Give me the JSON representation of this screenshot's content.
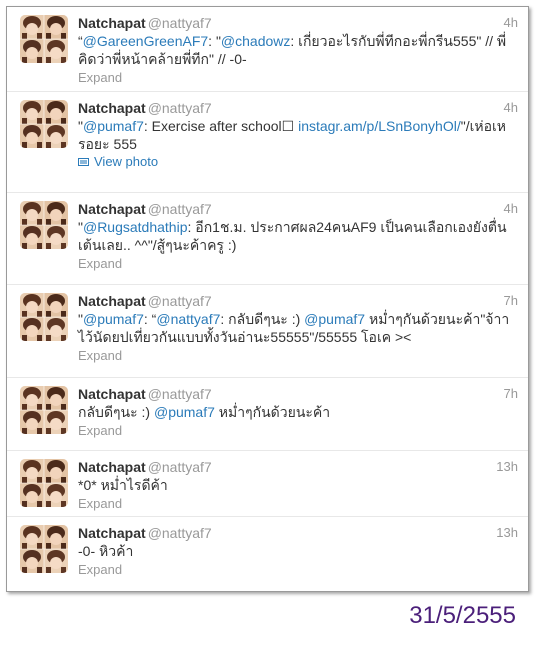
{
  "timeline": {
    "tweets": [
      {
        "fullname": "Natchapat",
        "username": "@nattyaf7",
        "time": "4h",
        "text_parts": [
          {
            "t": "“",
            "link": false
          },
          {
            "t": "@GareenGreenAF7",
            "link": true
          },
          {
            "t": ": \"",
            "link": false
          },
          {
            "t": "@chadowz",
            "link": true
          },
          {
            "t": ": เกี่ยวอะไรกับพี่ทีกอะพี่กรีน555\" // พี่คิดว่าพี่หน้าคล้ายพี่ทีก\" // -0-",
            "link": false
          }
        ],
        "expand": "Expand",
        "height": 85
      },
      {
        "fullname": "Natchapat",
        "username": "@nattyaf7",
        "time": "4h",
        "text_parts": [
          {
            "t": "\"",
            "link": false
          },
          {
            "t": "@pumaf7",
            "link": true
          },
          {
            "t": ": Exercise after school☐ ",
            "link": false
          },
          {
            "t": "instagr.am/p/LSnBonyhOl/",
            "link": true
          },
          {
            "t": "\"/เห่อเหรอยะ 555",
            "link": false
          }
        ],
        "view_photo": "View photo",
        "height": 101
      },
      {
        "fullname": "Natchapat",
        "username": "@nattyaf7",
        "time": "4h",
        "text_parts": [
          {
            "t": "\"",
            "link": false
          },
          {
            "t": "@Rugsatdhathip",
            "link": true
          },
          {
            "t": ": อีก1ช.ม. ประกาศผล24คนAF9 เป็นคนเลือกเองยังตื่นเต้นเลย.. ^^\"/สู้ๆนะค้าครู :)",
            "link": false
          }
        ],
        "expand": "Expand",
        "height": 92
      },
      {
        "fullname": "Natchapat",
        "username": "@nattyaf7",
        "time": "7h",
        "text_parts": [
          {
            "t": "\"",
            "link": false
          },
          {
            "t": "@pumaf7",
            "link": true
          },
          {
            "t": ": “",
            "link": false
          },
          {
            "t": "@nattyaf7",
            "link": true
          },
          {
            "t": ": กลับดีๆนะ :) ",
            "link": false
          },
          {
            "t": "@pumaf7",
            "link": true
          },
          {
            "t": " หม่ำๆกันด้วยนะค้า\"จ้าาไว้นัดยปเที่ยวกันแบบทั้งวันอ่านะ55555\"/55555 โอเค ><",
            "link": false
          }
        ],
        "expand": "Expand",
        "height": 93
      },
      {
        "fullname": "Natchapat",
        "username": "@nattyaf7",
        "time": "7h",
        "text_parts": [
          {
            "t": "กลับดีๆนะ :) ",
            "link": false
          },
          {
            "t": "@pumaf7",
            "link": true
          },
          {
            "t": " หม่ำๆกันด้วยนะค้า",
            "link": false
          }
        ],
        "expand": "Expand",
        "height": 73
      },
      {
        "fullname": "Natchapat",
        "username": "@nattyaf7",
        "time": "13h",
        "text_parts": [
          {
            "t": "*0* หม่ำไรดีค้า",
            "link": false
          }
        ],
        "expand": "Expand",
        "height": 66
      },
      {
        "fullname": "Natchapat",
        "username": "@nattyaf7",
        "time": "13h",
        "text_parts": [
          {
            "t": "-0- หิวค้า",
            "link": false
          }
        ],
        "expand": "Expand",
        "height": 74
      }
    ]
  },
  "date_stamp": "31/5/2555",
  "colors": {
    "link": "#2b7bb9",
    "muted": "#999999",
    "text": "#333333",
    "date_stamp": "#4b1f7a"
  },
  "icons": {
    "avatar": "profile-photo-collage",
    "view_photo": "photo-icon"
  }
}
